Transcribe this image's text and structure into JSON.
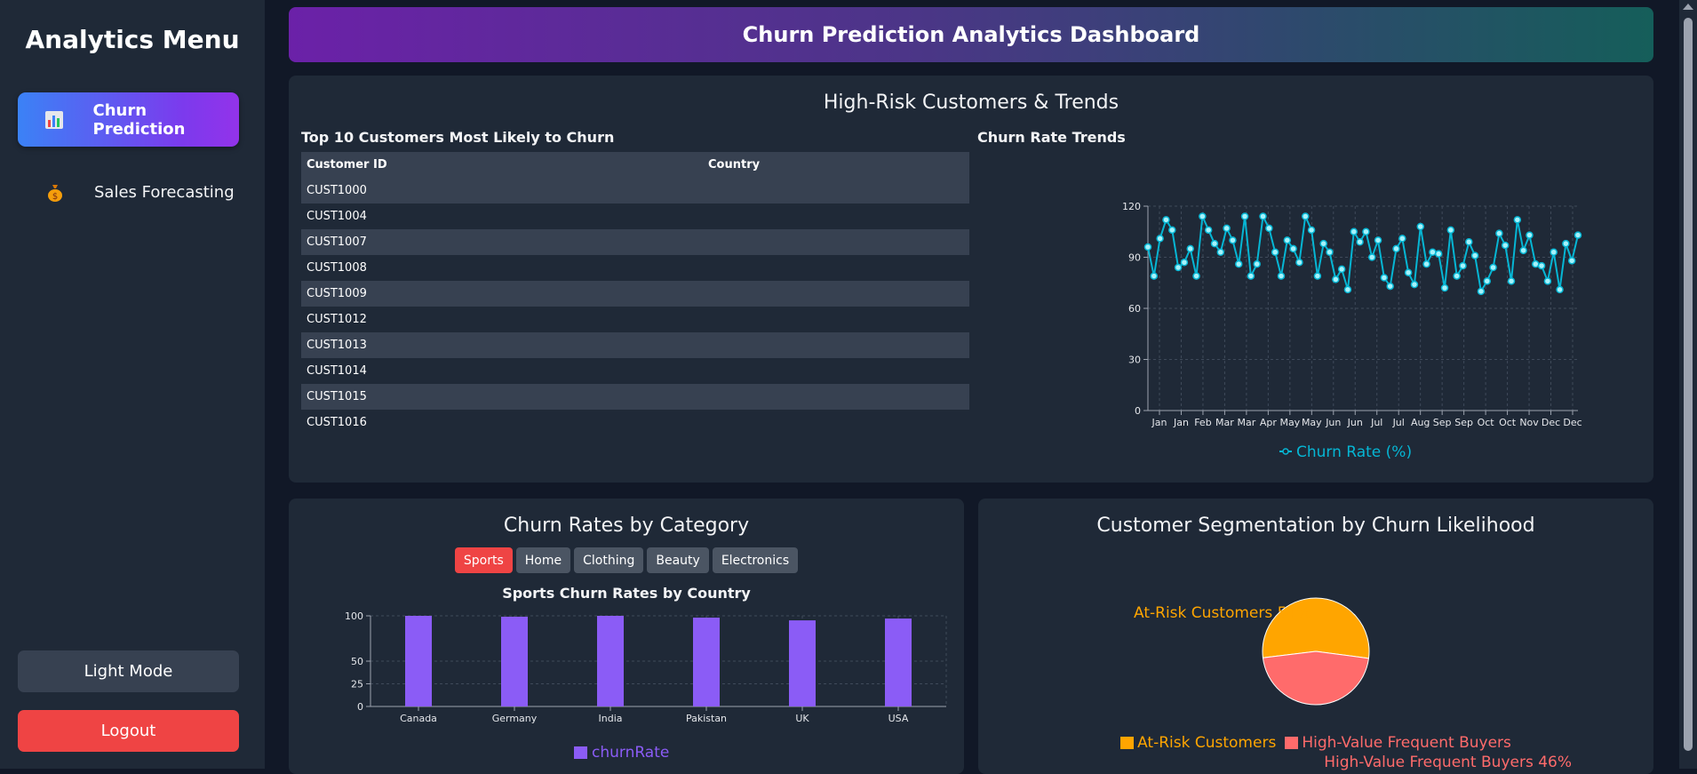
{
  "sidebar": {
    "title": "Analytics Menu",
    "items": [
      {
        "label": "Churn Prediction",
        "icon": "bar-chart-icon"
      },
      {
        "label": "Sales Forecasting",
        "icon": "money-bag-icon"
      }
    ],
    "theme_button": "Light Mode",
    "logout_button": "Logout"
  },
  "header": {
    "title": "Churn Prediction Analytics Dashboard"
  },
  "high_risk": {
    "title": "High-Risk Customers & Trends",
    "table_title": "Top 10 Customers Most Likely to Churn",
    "columns": [
      "Customer ID",
      "Country"
    ],
    "rows": [
      "CUST1000",
      "CUST1004",
      "CUST1007",
      "CUST1008",
      "CUST1009",
      "CUST1012",
      "CUST1013",
      "CUST1014",
      "CUST1015",
      "CUST1016"
    ],
    "trend_title": "Churn Rate Trends"
  },
  "category": {
    "title": "Churn Rates by Category",
    "filters": [
      "Sports",
      "Home",
      "Clothing",
      "Beauty",
      "Electronics"
    ],
    "active_filter": "Sports",
    "chart_title": "Sports Churn Rates by Country"
  },
  "segmentation": {
    "title": "Customer Segmentation by Churn Likelihood"
  },
  "colors": {
    "line": "#06b6d4",
    "bar": "#8b5cf6",
    "at_risk": "#ffa500",
    "high_value": "#ff6b6b"
  },
  "chart_data": [
    {
      "type": "line",
      "title": "Churn Rate Trends",
      "ylim": [
        0,
        120
      ],
      "yticks": [
        0,
        30,
        60,
        90,
        120
      ],
      "xticks": [
        "Jan",
        "Jan",
        "Feb",
        "Mar",
        "Mar",
        "Apr",
        "May",
        "May",
        "Jun",
        "Jun",
        "Jul",
        "Jul",
        "Aug",
        "Sep",
        "Sep",
        "Oct",
        "Oct",
        "Nov",
        "Dec",
        "Dec"
      ],
      "series": [
        {
          "name": "Churn Rate (%)",
          "values": [
            96,
            79,
            101,
            112,
            106,
            84,
            87,
            95,
            79,
            114,
            106,
            98,
            93,
            107,
            100,
            86,
            114,
            79,
            86,
            114,
            107,
            93,
            79,
            100,
            95,
            87,
            114,
            106,
            79,
            98,
            93,
            77,
            83,
            71,
            105,
            99,
            105,
            90,
            100,
            78,
            73,
            95,
            101,
            81,
            74,
            108,
            86,
            93,
            92,
            72,
            106,
            79,
            85,
            99,
            91,
            70,
            76,
            84,
            104,
            97,
            76,
            112,
            94,
            103,
            86,
            85,
            76,
            93,
            71,
            98,
            88,
            103
          ]
        }
      ],
      "grid": true,
      "legend": "bottom"
    },
    {
      "type": "bar",
      "title": "Sports Churn Rates by Country",
      "categories": [
        "Canada",
        "Germany",
        "India",
        "Pakistan",
        "UK",
        "USA"
      ],
      "ylim": [
        0,
        100
      ],
      "yticks": [
        0,
        25,
        50,
        100
      ],
      "series": [
        {
          "name": "churnRate",
          "values": [
            100,
            99,
            100,
            98,
            95,
            97
          ]
        }
      ],
      "grid": true,
      "legend": "bottom"
    },
    {
      "type": "pie",
      "title": "Customer Segmentation by Churn Likelihood",
      "slices": [
        {
          "label": "At-Risk Customers",
          "value": 54,
          "text": "At-Risk Customers 54%"
        },
        {
          "label": "High-Value Frequent Buyers",
          "value": 46,
          "text": "High-Value Frequent Buyers 46%"
        }
      ],
      "legend": "bottom"
    }
  ]
}
